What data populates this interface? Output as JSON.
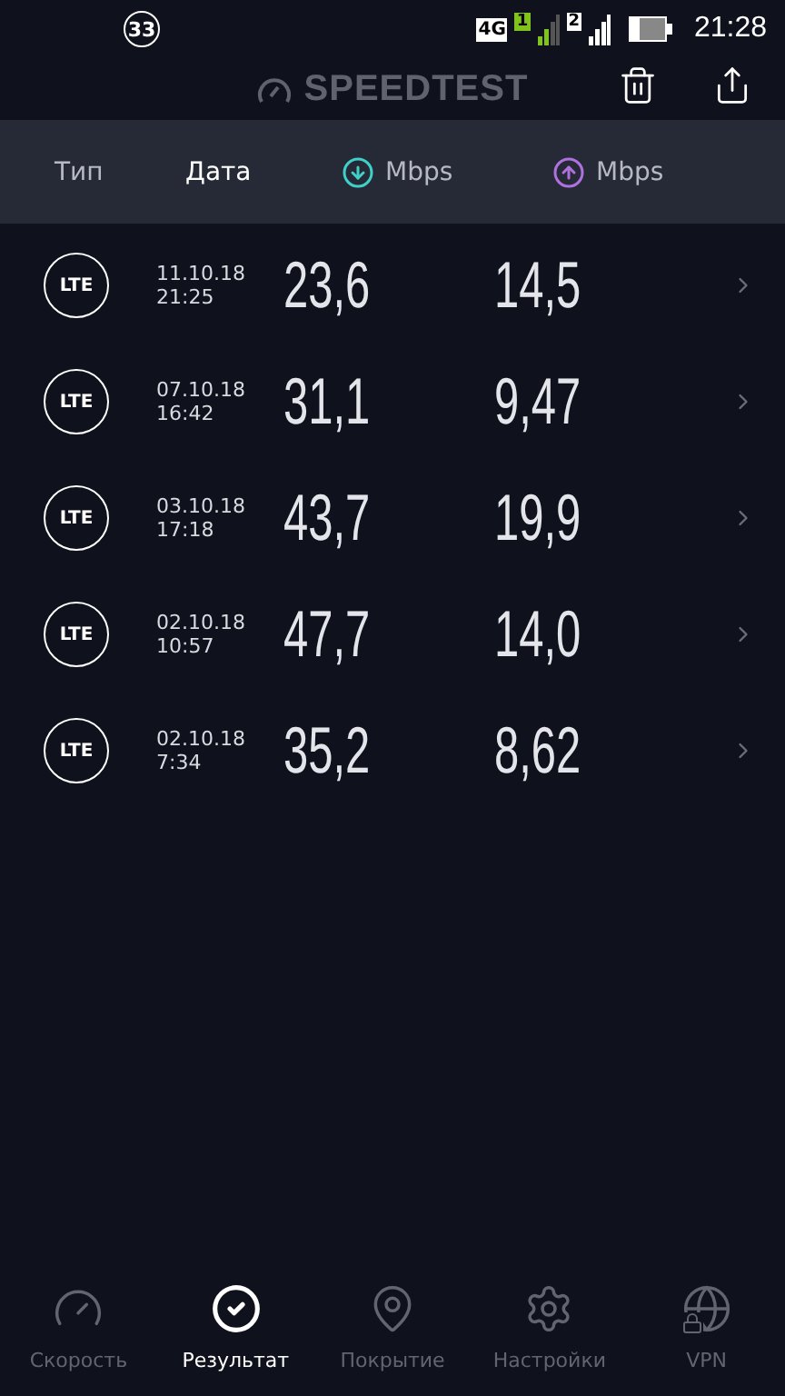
{
  "status_bar": {
    "notification_count": "33",
    "network": "4G",
    "sim_1": "1",
    "sim_2": "2",
    "time": "21:28"
  },
  "app_bar": {
    "title": "SPEEDTEST"
  },
  "columns": [
    {
      "label": "Тип",
      "kind": "text",
      "selected": false
    },
    {
      "label": "Дата",
      "kind": "text",
      "selected": true
    },
    {
      "label": "Mbps",
      "kind": "download",
      "selected": false
    },
    {
      "label": "Mbps",
      "kind": "upload",
      "selected": false
    }
  ],
  "results": [
    {
      "type": "LTE",
      "date": "11.10.18",
      "time": "21:25",
      "download": "23,6",
      "upload": "14,5"
    },
    {
      "type": "LTE",
      "date": "07.10.18",
      "time": "16:42",
      "download": "31,1",
      "upload": "9,47"
    },
    {
      "type": "LTE",
      "date": "03.10.18",
      "time": "17:18",
      "download": "43,7",
      "upload": "19,9"
    },
    {
      "type": "LTE",
      "date": "02.10.18",
      "time": "10:57",
      "download": "47,7",
      "upload": "14,0"
    },
    {
      "type": "LTE",
      "date": "02.10.18",
      "time": "7:34",
      "download": "35,2",
      "upload": "8,62"
    }
  ],
  "nav": [
    {
      "label": "Скорость",
      "kind": "speed",
      "selected": false
    },
    {
      "label": "Результат",
      "kind": "results",
      "selected": true
    },
    {
      "label": "Покрытие",
      "kind": "coverage",
      "selected": false
    },
    {
      "label": "Настройки",
      "kind": "settings",
      "selected": false
    },
    {
      "label": "VPN",
      "kind": "vpn",
      "selected": false
    }
  ]
}
